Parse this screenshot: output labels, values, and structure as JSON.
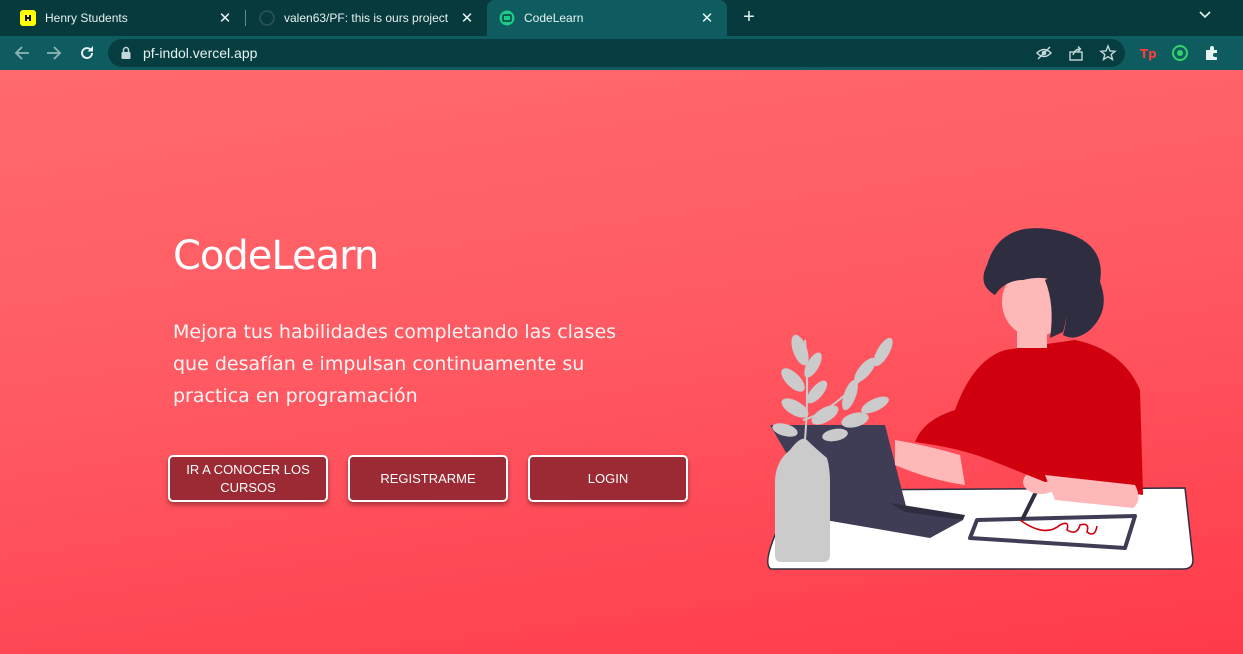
{
  "browser": {
    "tabs": [
      {
        "title": "Henry Students"
      },
      {
        "title": "valen63/PF: this is ours project"
      },
      {
        "title": "CodeLearn"
      }
    ],
    "address": "pf-indol.vercel.app"
  },
  "hero": {
    "title": "CodeLearn",
    "text": "Mejora tus habilidades completando las clases que desafían e impulsan continuamente su practica en programación",
    "buttons": {
      "courses": "IR A CONOCER LOS CURSOS",
      "register": "REGISTRARME",
      "login": "LOGIN"
    }
  },
  "colors": {
    "tabstrip": "#063a3c",
    "toolbar": "#0f5c60",
    "page_top": "#ff6a6c",
    "page_bottom": "#ff3a4a",
    "button_bg": "#9b2a34",
    "shirt": "#d0000f",
    "hair": "#2f2e41",
    "plant": "#cbcbcb"
  },
  "icons": [
    "henry-favicon",
    "github-favicon",
    "codelearn-favicon",
    "close-icon",
    "new-tab-icon",
    "tab-search-icon",
    "back-icon",
    "forward-icon",
    "reload-icon",
    "lock-icon",
    "eye-off-icon",
    "share-icon",
    "star-icon",
    "tp-extension-icon",
    "circle-extension-icon",
    "puzzle-icon"
  ]
}
